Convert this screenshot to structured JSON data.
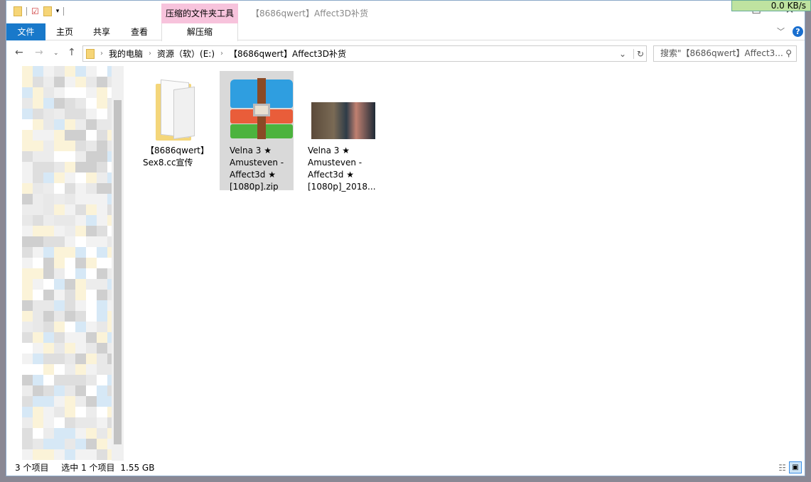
{
  "titlebar": {
    "context_group": "压缩的文件夹工具",
    "title": "【8686qwert】Affect3D补货",
    "network": "0.0 KB/s"
  },
  "ribbon": {
    "tabs": [
      "文件",
      "主页",
      "共享",
      "查看"
    ],
    "context_tab": "解压缩"
  },
  "address": {
    "crumbs": [
      "我的电脑",
      "资源（软）(E:)",
      "【8686qwert】Affect3D补货"
    ],
    "search_placeholder": "搜索\"【8686qwert】Affect3... "
  },
  "files": [
    {
      "name_line1": "【8686qwert】",
      "name_line2": "Sex8.cc宣传",
      "type": "folder",
      "selected": false
    },
    {
      "name_lines": [
        "Velna 3 ★",
        "Amusteven -",
        "Affect3d ★",
        "[1080p].zip"
      ],
      "type": "zip-archive",
      "selected": true
    },
    {
      "name_lines": [
        "Velna 3 ★",
        "Amusteven -",
        "Affect3d ★",
        "[1080p]_2018..."
      ],
      "type": "image-thumbnail",
      "selected": false
    }
  ],
  "status": {
    "count": "3 个项目",
    "selection": "选中 1 个项目",
    "size": "1.55 GB"
  }
}
